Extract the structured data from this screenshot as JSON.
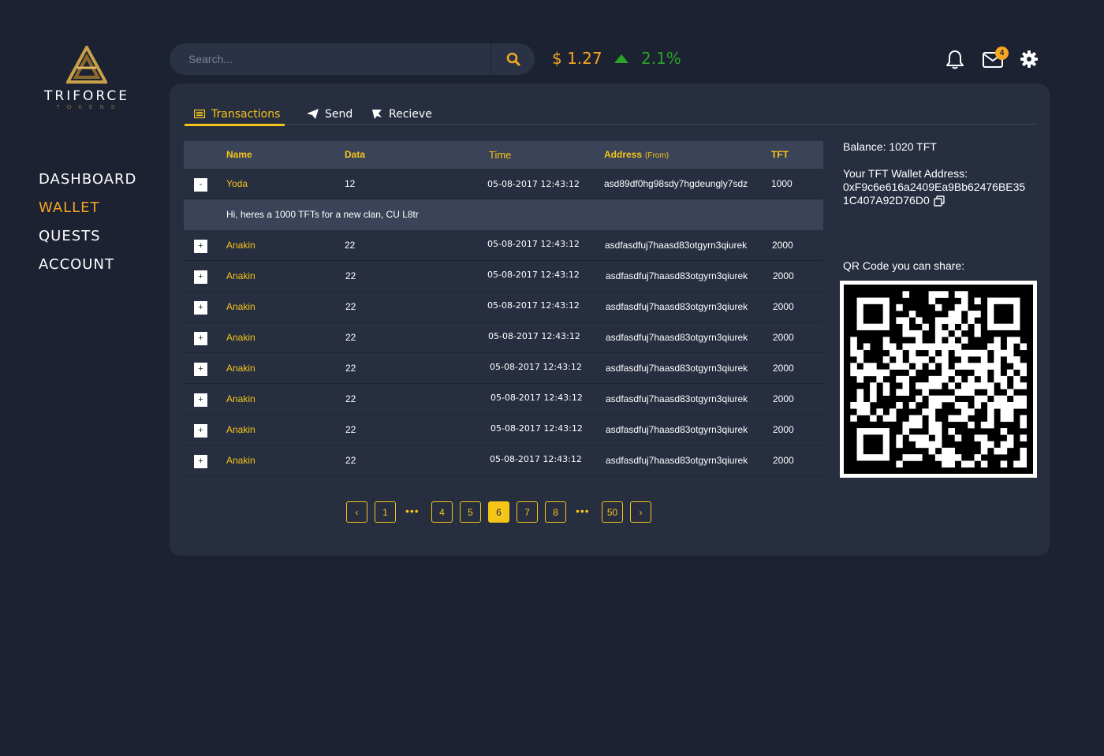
{
  "brand": {
    "name": "TRIFORCE",
    "sub": "TOKENS"
  },
  "nav": [
    {
      "label": "DASHBOARD",
      "active": false
    },
    {
      "label": "WALLET",
      "active": true
    },
    {
      "label": "QUESTS",
      "active": false
    },
    {
      "label": "ACCOUNT",
      "active": false
    }
  ],
  "search": {
    "placeholder": "Search..."
  },
  "ticker": {
    "price": "$ 1.27",
    "change": "2.1%"
  },
  "notifications": {
    "mail_count": "4"
  },
  "tabs": [
    "Transactions",
    "Send",
    "Recieve"
  ],
  "table": {
    "headers": {
      "name": "Name",
      "data": "Data",
      "time": "Time",
      "address": "Address",
      "address_note": "(From)",
      "tft": "TFT"
    },
    "expanded": {
      "toggle": "-",
      "name": "Yoda",
      "data": "12",
      "time": "05-08-2017 12:43:12",
      "address": "asd89df0hg98sdy7hgdeungly7sdz",
      "tft": "1000",
      "message": "Hi, heres a 1000 TFTs for a new clan, CU L8tr"
    },
    "rows": [
      {
        "toggle": "+",
        "name": "Anakin",
        "data": "22",
        "time": "05-08-2017 12:43:12",
        "address": "asdfasdfuj7haasd83otgyrn3qiurek",
        "tft": "2000"
      },
      {
        "toggle": "+",
        "name": "Anakin",
        "data": "22",
        "time": "05-08-2017 12:43:12",
        "address": "asdfasdfuj7haasd83otgyrn3qiurek",
        "tft": "2000"
      },
      {
        "toggle": "+",
        "name": "Anakin",
        "data": "22",
        "time": "05-08-2017 12:43:12",
        "address": "asdfasdfuj7haasd83otgyrn3qiurek",
        "tft": "2000"
      },
      {
        "toggle": "+",
        "name": "Anakin",
        "data": "22",
        "time": "05-08-2017 12:43:12",
        "address": "asdfasdfuj7haasd83otgyrn3qiurek",
        "tft": "2000"
      },
      {
        "toggle": "+",
        "name": "Anakin",
        "data": "22",
        "time": "05-08-2017 12:43:12",
        "address": "asdfasdfuj7haasd83otgyrn3qiurek",
        "tft": "2000"
      },
      {
        "toggle": "+",
        "name": "Anakin",
        "data": "22",
        "time": "05-08-2017 12:43:12",
        "address": "asdfasdfuj7haasd83otgyrn3qiurek",
        "tft": "2000"
      },
      {
        "toggle": "+",
        "name": "Anakin",
        "data": "22",
        "time": "05-08-2017 12:43:12",
        "address": "asdfasdfuj7haasd83otgyrn3qiurek",
        "tft": "2000"
      },
      {
        "toggle": "+",
        "name": "Anakin",
        "data": "22",
        "time": "05-08-2017 12:43:12",
        "address": "asdfasdfuj7haasd83otgyrn3qiurek",
        "tft": "2000"
      }
    ]
  },
  "pagination": {
    "prev": "‹",
    "next": "›",
    "ellipsis": "•••",
    "pages": [
      "1",
      "4",
      "5",
      "6",
      "7",
      "8",
      "50"
    ],
    "current": "6"
  },
  "wallet": {
    "balance": "Balance: 1020 TFT",
    "address_label": "Your TFT Wallet Address:",
    "address_line1": "0xF9c6e616a2409Ea9Bb62476BE35",
    "address_line2": "1C407A92D76D0",
    "qr_label": "QR Code you can share:"
  },
  "colors": {
    "accent": "#f5a623",
    "highlight": "#f5c518",
    "positive": "#2aa32a",
    "background": "#1d2232",
    "panel": "#272e40"
  }
}
